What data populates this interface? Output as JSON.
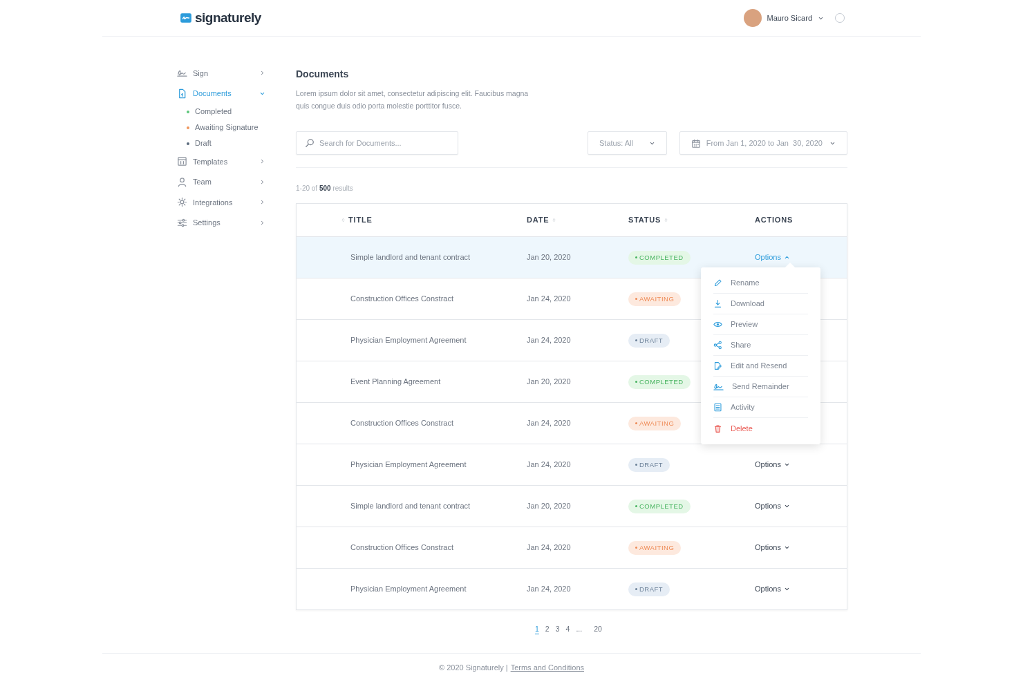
{
  "header": {
    "logo": "signaturely",
    "user": {
      "name": "Mauro Sicard"
    }
  },
  "sidebar": {
    "items": [
      {
        "kind": "sign",
        "label": "Sign",
        "expanded": false,
        "selected": false
      },
      {
        "kind": "document",
        "label": "Documents",
        "expanded": true,
        "selected": true,
        "children": [
          {
            "label": "Completed",
            "color": "#5cc67a"
          },
          {
            "label": "Awaiting Signature",
            "color": "#f0955c"
          },
          {
            "label": "Draft",
            "color": "#5b6b7d"
          }
        ]
      },
      {
        "kind": "template",
        "label": "Templates",
        "expanded": false,
        "selected": false
      },
      {
        "kind": "team",
        "label": "Team",
        "expanded": false,
        "selected": false
      },
      {
        "kind": "integrations",
        "label": "Integrations",
        "expanded": false,
        "selected": false
      },
      {
        "kind": "settings",
        "label": "Settings",
        "expanded": false,
        "selected": false
      }
    ]
  },
  "page": {
    "title": "Documents",
    "description": "Lorem ipsum dolor sit amet, consectetur adipiscing elit. Faucibus magna quis congue duis odio porta molestie porttitor fusce."
  },
  "filters": {
    "search": {
      "placeholder": "Search for Documents..."
    },
    "status": "Status: All",
    "date_range": "From Jan 1, 2020 to Jan  30, 2020"
  },
  "results": "1-20 of **500** results",
  "table": {
    "columns": [
      {
        "label": "TITLE"
      },
      {
        "label": "DATE"
      },
      {
        "label": "STATUS"
      },
      {
        "label": "ACTIONS"
      }
    ],
    "rows": [
      {
        "title": "Simple landlord and tenant contract",
        "date": "Jan 20, 2020",
        "status": {
          "label": "COMPLETED",
          "kind": "completed"
        },
        "selected": true,
        "action": {
          "label": "Options",
          "expanded": true
        }
      },
      {
        "title": "Construction Offices Constract",
        "date": "Jan 24, 2020",
        "status": {
          "label": "AWAITING",
          "kind": "awaiting"
        },
        "selected": false
      },
      {
        "title": "Physician Employment Agreement",
        "date": "Jan 24, 2020",
        "status": {
          "label": "DRAFT",
          "kind": "draft"
        },
        "selected": false
      },
      {
        "title": "Event Planning Agreement",
        "date": "Jan 20, 2020",
        "status": {
          "label": "COMPLETED",
          "kind": "completed"
        },
        "selected": false
      },
      {
        "title": "Construction Offices Constract",
        "date": "Jan 24, 2020",
        "status": {
          "label": "AWAITING",
          "kind": "awaiting"
        },
        "selected": false
      },
      {
        "title": "Physician Employment Agreement",
        "date": "Jan 24, 2020",
        "status": {
          "label": "DRAFT",
          "kind": "draft"
        },
        "selected": false,
        "action": {
          "label": "Options",
          "expanded": false
        }
      },
      {
        "title": "Simple landlord and tenant contract",
        "date": "Jan 20, 2020",
        "status": {
          "label": "COMPLETED",
          "kind": "completed"
        },
        "selected": false,
        "action": {
          "label": "Options",
          "expanded": false
        }
      },
      {
        "title": "Construction Offices Constract",
        "date": "Jan 24, 2020",
        "status": {
          "label": "AWAITING",
          "kind": "awaiting"
        },
        "selected": false,
        "action": {
          "label": "Options",
          "expanded": false
        }
      },
      {
        "title": "Physician Employment Agreement",
        "date": "Jan 24, 2020",
        "status": {
          "label": "DRAFT",
          "kind": "draft"
        },
        "selected": false,
        "action": {
          "label": "Options",
          "expanded": false
        }
      }
    ]
  },
  "options_menu": {
    "items": [
      {
        "kind": "pencil",
        "label": "Rename",
        "danger": false
      },
      {
        "kind": "download",
        "label": "Download",
        "danger": false
      },
      {
        "kind": "eye",
        "label": "Preview",
        "danger": false
      },
      {
        "kind": "share",
        "label": "Share",
        "danger": false
      },
      {
        "kind": "edit-doc",
        "label": "Edit and Resend",
        "danger": false
      },
      {
        "kind": "sign",
        "label": "Send Remainder",
        "danger": false
      },
      {
        "kind": "list",
        "label": "Activity",
        "danger": false
      },
      {
        "kind": "trash",
        "label": "Delete",
        "danger": true
      }
    ]
  },
  "pagination": [
    {
      "label": "1",
      "selected": true
    },
    {
      "label": "2",
      "selected": false
    },
    {
      "label": "3",
      "selected": false
    },
    {
      "label": "4",
      "selected": false
    },
    {
      "label": "...",
      "selected": false
    },
    {
      "label": "20",
      "selected": false
    }
  ],
  "footer": {
    "copyright": "© 2020 Signaturely |",
    "link": "Terms and Conditions"
  }
}
